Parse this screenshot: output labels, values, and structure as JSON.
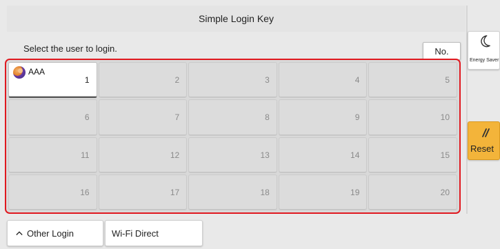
{
  "header": {
    "title": "Simple Login Key"
  },
  "main": {
    "instruction": "Select the user to login.",
    "number_button_label": "No.",
    "keys": [
      {
        "number": "1",
        "user": "AAA",
        "active": true
      },
      {
        "number": "2",
        "user": "",
        "active": false
      },
      {
        "number": "3",
        "user": "",
        "active": false
      },
      {
        "number": "4",
        "user": "",
        "active": false
      },
      {
        "number": "5",
        "user": "",
        "active": false
      },
      {
        "number": "6",
        "user": "",
        "active": false
      },
      {
        "number": "7",
        "user": "",
        "active": false
      },
      {
        "number": "8",
        "user": "",
        "active": false
      },
      {
        "number": "9",
        "user": "",
        "active": false
      },
      {
        "number": "10",
        "user": "",
        "active": false
      },
      {
        "number": "11",
        "user": "",
        "active": false
      },
      {
        "number": "12",
        "user": "",
        "active": false
      },
      {
        "number": "13",
        "user": "",
        "active": false
      },
      {
        "number": "14",
        "user": "",
        "active": false
      },
      {
        "number": "15",
        "user": "",
        "active": false
      },
      {
        "number": "16",
        "user": "",
        "active": false
      },
      {
        "number": "17",
        "user": "",
        "active": false
      },
      {
        "number": "18",
        "user": "",
        "active": false
      },
      {
        "number": "19",
        "user": "",
        "active": false
      },
      {
        "number": "20",
        "user": "",
        "active": false
      }
    ]
  },
  "sidebar": {
    "energy_saver_label": "Energy Saver",
    "energy_saver_icon": "moon-icon",
    "reset_label": "Reset",
    "reset_icon": "reset-slash-icon",
    "reset_color": "#f3b43a"
  },
  "footer": {
    "other_login_label": "Other Login",
    "other_login_icon": "chevron-up-icon",
    "wifi_direct_label": "Wi-Fi Direct"
  },
  "colors": {
    "highlight_frame": "#e0181f"
  }
}
